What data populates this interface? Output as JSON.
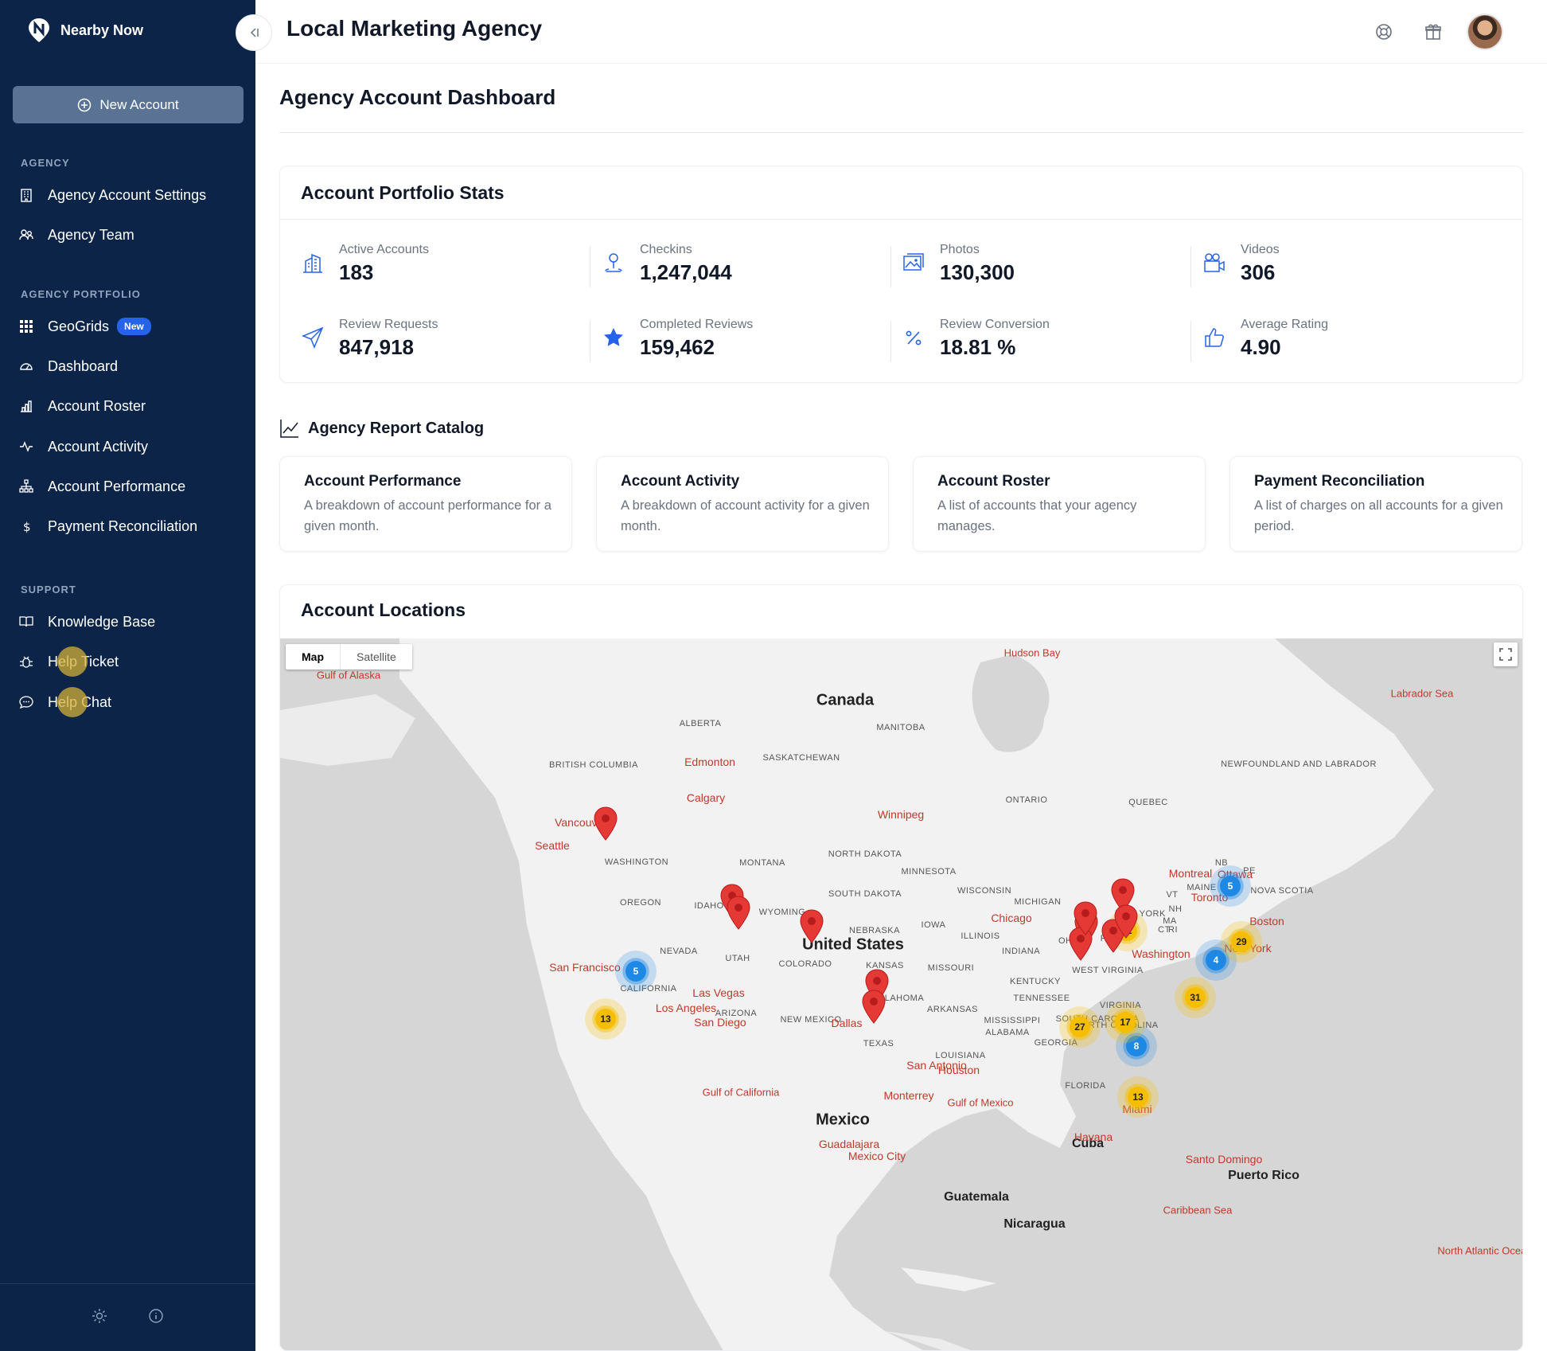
{
  "brand": {
    "name": "Nearby Now"
  },
  "sidebar": {
    "new_account_label": "New Account",
    "sections": {
      "agency": "AGENCY",
      "portfolio": "AGENCY PORTFOLIO",
      "support": "SUPPORT"
    },
    "items": [
      {
        "label": "Agency Account Settings",
        "icon": "building-icon"
      },
      {
        "label": "Agency Team",
        "icon": "users-icon"
      },
      {
        "label": "GeoGrids",
        "icon": "grid-icon",
        "badge": "New"
      },
      {
        "label": "Dashboard",
        "icon": "gauge-icon"
      },
      {
        "label": "Account Roster",
        "icon": "chart-icon"
      },
      {
        "label": "Account Activity",
        "icon": "activity-icon"
      },
      {
        "label": "Account Performance",
        "icon": "hierarchy-icon"
      },
      {
        "label": "Payment Reconciliation",
        "icon": "dollar-icon"
      },
      {
        "label": "Knowledge Base",
        "icon": "book-icon"
      },
      {
        "label": "Help Ticket",
        "icon": "bug-icon"
      },
      {
        "label": "Help Chat",
        "icon": "chat-icon"
      }
    ]
  },
  "header": {
    "title": "Local Marketing Agency"
  },
  "page": {
    "title": "Agency Account Dashboard"
  },
  "stats": {
    "title": "Account Portfolio Stats",
    "items": [
      {
        "label": "Active Accounts",
        "value": "183",
        "icon": "building-icon"
      },
      {
        "label": "Checkins",
        "value": "1,247,044",
        "icon": "person-pin-icon"
      },
      {
        "label": "Photos",
        "value": "130,300",
        "icon": "photos-icon"
      },
      {
        "label": "Videos",
        "value": "306",
        "icon": "video-icon"
      },
      {
        "label": "Review Requests",
        "value": "847,918",
        "icon": "send-icon"
      },
      {
        "label": "Completed Reviews",
        "value": "159,462",
        "icon": "star-icon"
      },
      {
        "label": "Review Conversion",
        "value": "18.81 %",
        "icon": "percent-icon"
      },
      {
        "label": "Average Rating",
        "value": "4.90",
        "icon": "thumbs-up-icon"
      }
    ]
  },
  "catalog": {
    "title": "Agency Report Catalog",
    "reports": [
      {
        "title": "Account Performance",
        "desc": "A breakdown of account performance for a given month."
      },
      {
        "title": "Account Activity",
        "desc": "A breakdown of account activity for a given month."
      },
      {
        "title": "Account Roster",
        "desc": "A list of accounts that your agency manages."
      },
      {
        "title": "Payment Reconciliation",
        "desc": "A list of charges on all accounts for a given period."
      }
    ]
  },
  "locations": {
    "title": "Account Locations",
    "map_type_options": [
      "Map",
      "Satellite"
    ],
    "selected_map_type": "Map",
    "countries": [
      "Canada",
      "United States",
      "Mexico",
      "Cuba",
      "Guatemala",
      "Puerto Rico",
      "Nicaragua"
    ],
    "water": [
      "Hudson Bay",
      "Gulf of Alaska",
      "Labrador Sea",
      "Gulf of Mexico",
      "Gulf of California",
      "Caribbean Sea",
      "North Atlantic Ocean"
    ],
    "regions": [
      "BRITISH COLUMBIA",
      "ALBERTA",
      "SASKATCHEWAN",
      "MANITOBA",
      "ONTARIO",
      "QUEBEC",
      "NEWFOUNDLAND AND LABRADOR",
      "WASHINGTON",
      "OREGON",
      "CALIFORNIA",
      "NEVADA",
      "IDAHO",
      "MONTANA",
      "WYOMING",
      "UTAH",
      "ARIZONA",
      "COLORADO",
      "NEW MEXICO",
      "NORTH DAKOTA",
      "SOUTH DAKOTA",
      "NEBRASKA",
      "KANSAS",
      "OKLAHOMA",
      "TEXAS",
      "MINNESOTA",
      "IOWA",
      "MISSOURI",
      "ARKANSAS",
      "LOUISIANA",
      "WISCONSIN",
      "ILLINOIS",
      "MICHIGAN",
      "INDIANA",
      "OHIO",
      "KENTUCKY",
      "TENNESSEE",
      "MISSISSIPPI",
      "ALABAMA",
      "GEORGIA",
      "FLORIDA",
      "SOUTH CAROLINA",
      "NORTH CAROLINA",
      "VIRGINIA",
      "WEST VIRGINIA",
      "PENN",
      "NEW YORK",
      "VT",
      "NH",
      "MAINE",
      "MA",
      "CT",
      "RI",
      "NB",
      "PE",
      "NOVA SCOTIA"
    ],
    "cities": [
      "Edmonton",
      "Calgary",
      "Winnipeg",
      "Vancouver",
      "Seattle",
      "San Francisco",
      "Las Vegas",
      "Los Angeles",
      "San Diego",
      "Dallas",
      "San Antonio",
      "Houston",
      "Chicago",
      "Toronto",
      "Ottawa",
      "Montreal",
      "Boston",
      "New York",
      "Washington",
      "Miami",
      "Havana",
      "Monterrey",
      "Guadalajara",
      "Mexico City",
      "Santo Domingo"
    ],
    "clusters": [
      {
        "count": "5",
        "color": "blue"
      },
      {
        "count": "4",
        "color": "blue"
      },
      {
        "count": "5",
        "color": "blue"
      },
      {
        "count": "8",
        "color": "blue"
      },
      {
        "count": "12",
        "color": "yellow"
      },
      {
        "count": "29",
        "color": "yellow"
      },
      {
        "count": "31",
        "color": "yellow"
      },
      {
        "count": "17",
        "color": "yellow"
      },
      {
        "count": "27",
        "color": "yellow"
      },
      {
        "count": "13",
        "color": "yellow"
      },
      {
        "count": "13",
        "color": "yellow"
      }
    ],
    "marker_count": 12
  },
  "colors": {
    "sidebar": "#0b2447",
    "accent": "#2563eb",
    "pin": "#e53935"
  }
}
